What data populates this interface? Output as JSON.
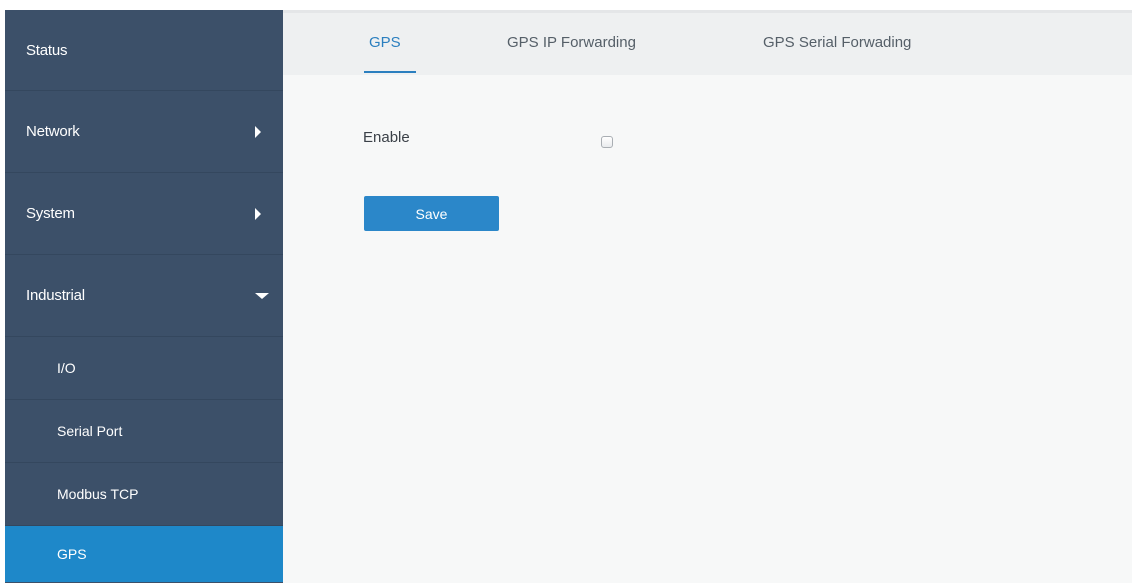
{
  "sidebar": {
    "items": [
      {
        "label": "Status"
      },
      {
        "label": "Network"
      },
      {
        "label": "System"
      },
      {
        "label": "Industrial"
      }
    ],
    "sub_items": [
      {
        "label": "I/O"
      },
      {
        "label": "Serial Port"
      },
      {
        "label": "Modbus TCP"
      },
      {
        "label": "GPS"
      }
    ],
    "active_item": "GPS"
  },
  "tabs": [
    {
      "label": "GPS"
    },
    {
      "label": "GPS IP Forwarding"
    },
    {
      "label": "GPS Serial Forwading"
    }
  ],
  "active_tab": "GPS",
  "form": {
    "enable_label": "Enable",
    "enable_checked": false,
    "save_label": "Save"
  },
  "colors": {
    "sidebar_bg": "#3c5069",
    "active_bg": "#1e88c9",
    "accent": "#2b7fbf",
    "content_bg": "#f7f8f8",
    "tabbar_bg": "#eef0f1"
  },
  "icons": {
    "network_expand": "chevron-right-icon",
    "system_expand": "chevron-right-icon",
    "industrial_collapse": "chevron-down-icon"
  }
}
